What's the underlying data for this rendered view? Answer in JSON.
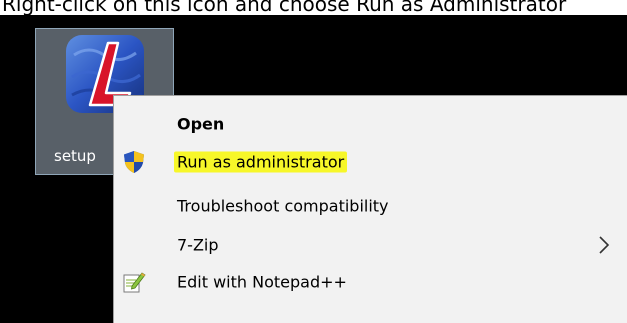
{
  "caption": "Right-click on this icon and choose Run as Administrator",
  "desktop_icon": {
    "label": "setup",
    "icon": "app-logo-icon"
  },
  "context_menu": {
    "items": [
      {
        "label": "Open",
        "bold": true,
        "icon": ""
      },
      {
        "label": "Run as administrator",
        "highlighted": true,
        "icon": "uac-shield-icon"
      },
      {
        "label": "Troubleshoot compatibility",
        "icon": ""
      },
      {
        "label": "7-Zip",
        "has_submenu": true,
        "icon": ""
      },
      {
        "label": "Edit with Notepad++",
        "icon": "notepad-plus-plus-icon"
      }
    ]
  },
  "colors": {
    "desktop_bg": "#000000",
    "menu_bg": "#f2f2f2",
    "highlight": "#f7f729",
    "selection_tile": "#a0afbe"
  }
}
